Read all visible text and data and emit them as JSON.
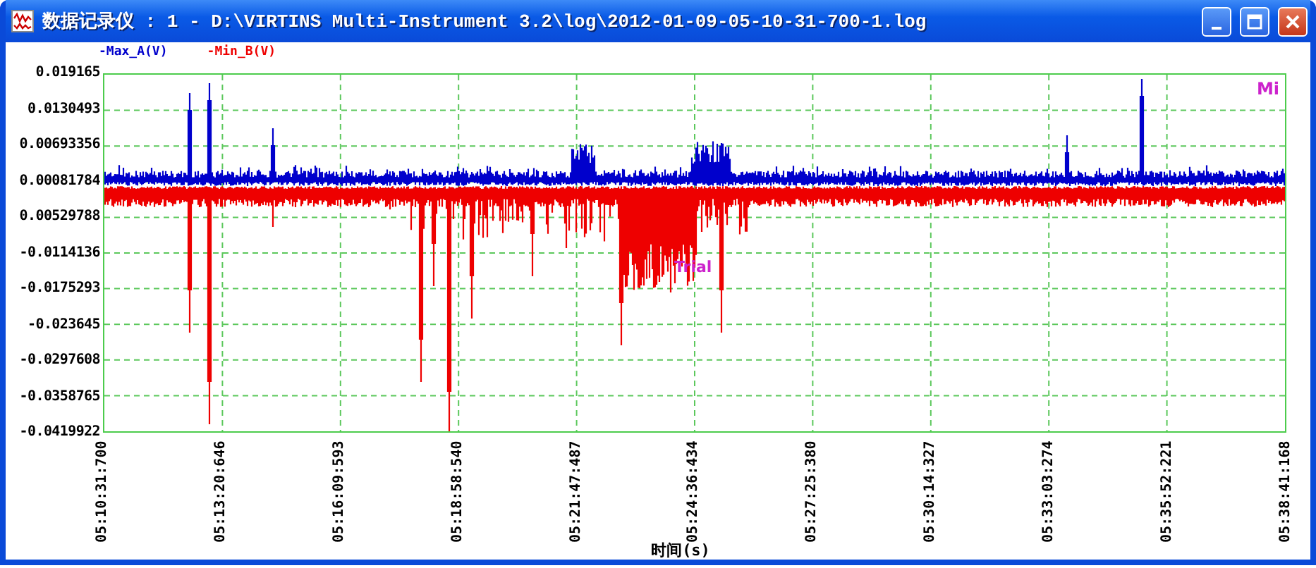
{
  "window": {
    "title": "数据记录仪 : 1 - D:\\VIRTINS Multi-Instrument 3.2\\log\\2012-01-09-05-10-31-700-1.log"
  },
  "legend": [
    {
      "label": "-Max_A(V)",
      "color": "#0000cc"
    },
    {
      "label": "-Min_B(V)",
      "color": "#ee0000"
    }
  ],
  "chart": {
    "yticks": [
      "0.019165",
      "0.0130493",
      "0.00693356",
      "0.00081784",
      "0.00529788",
      "-0.0114136",
      "-0.0175293",
      "-0.023645",
      "-0.0297608",
      "-0.0358765",
      "-0.0419922"
    ],
    "xticks": [
      "05:10:31:700",
      "05:13:20:646",
      "05:16:09:593",
      "05:18:58:540",
      "05:21:47:487",
      "05:24:36:434",
      "05:27:25:380",
      "05:30:14:327",
      "05:33:03:274",
      "05:35:52:221",
      "05:38:41:168"
    ],
    "xlabel": "时间(s)",
    "annotations": [
      {
        "text": "Mi"
      },
      {
        "text": "Trial"
      }
    ]
  }
}
